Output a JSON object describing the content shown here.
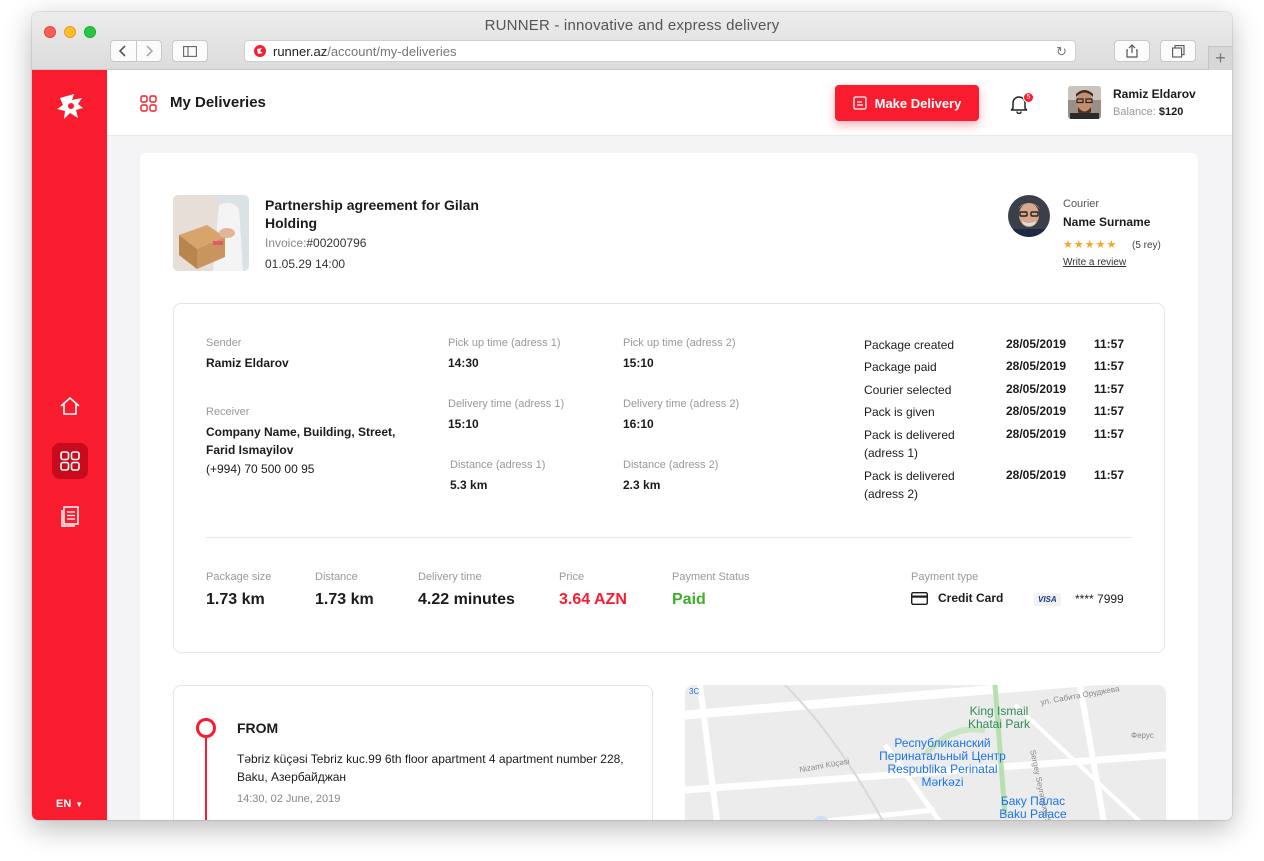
{
  "browser": {
    "title": "RUNNER - innovative and express delivery",
    "url_domain": "runner.az",
    "url_path": "/account/my-deliveries"
  },
  "sidebar": {
    "language": "EN",
    "items": [
      {
        "icon": "home-icon"
      },
      {
        "icon": "grid-icon",
        "active": true
      },
      {
        "icon": "document-icon"
      }
    ]
  },
  "header": {
    "title": "My Deliveries",
    "make_delivery_label": "Make Delivery",
    "notification_count": "5",
    "user_name": "Ramiz Eldarov",
    "balance_label": "Balance:",
    "balance_value": "$120"
  },
  "order": {
    "title": "Partnership agreement for Gilan Holding",
    "invoice_label": "Invoice:",
    "invoice_number": "#00200796",
    "date": "01.05.29 14:00"
  },
  "courier": {
    "label": "Courier",
    "name": "Name Surname",
    "stars": "★★★★★",
    "rating_count": "(5 rey)",
    "review_link": "Write a review"
  },
  "details": {
    "sender_label": "Sender",
    "sender_name": "Ramiz Eldarov",
    "receiver_label": "Receiver",
    "receiver_name": "Company Name, Building, Street, Farid Ismayilov",
    "receiver_phone": "(+994) 70 500 00 95",
    "pickup1_label": "Pick up time (adress 1)",
    "pickup1_value": "14:30",
    "pickup2_label": "Pick up time (adress 2)",
    "pickup2_value": "15:10",
    "delivery1_label": "Delivery time (adress 1)",
    "delivery1_value": "15:10",
    "delivery2_label": "Delivery time (adress 2)",
    "delivery2_value": "16:10",
    "distance1_label": "Distance (adress 1)",
    "distance1_value": "5.3 km",
    "distance2_label": "Distance (adress 2)",
    "distance2_value": "2.3 km"
  },
  "timeline": [
    {
      "label": "Package created",
      "date": "28/05/2019",
      "time": "11:57"
    },
    {
      "label": "Package paid",
      "date": "28/05/2019",
      "time": "11:57"
    },
    {
      "label": "Courier selected",
      "date": "28/05/2019",
      "time": "11:57"
    },
    {
      "label": "Pack is given",
      "date": "28/05/2019",
      "time": "11:57"
    },
    {
      "label": "Pack is delivered (adress 1)",
      "date": "28/05/2019",
      "time": "11:57"
    },
    {
      "label": "Pack is delivered (adress 2)",
      "date": "28/05/2019",
      "time": "11:57"
    }
  ],
  "summary": {
    "package_size_label": "Package size",
    "package_size_value": "1.73 km",
    "distance_label": "Distance",
    "distance_value": "1.73 km",
    "delivery_time_label": "Delivery time",
    "delivery_time_value": "4.22 minutes",
    "price_label": "Price",
    "price_value": "3.64 AZN",
    "payment_status_label": "Payment Status",
    "payment_status_value": "Paid",
    "payment_type_label": "Payment type",
    "payment_type_value": "Credit Card",
    "card_brand": "VISA",
    "card_number": "**** 7999"
  },
  "from": {
    "title": "FROM",
    "address": "Təbriz küçəsi Tebriz kuc.99 6th floor apartment 4 apartment number 228, Baku, Азербайджан",
    "time": "14:30, 02 June, 2019"
  },
  "map": {
    "park": "King Ismail Khatai Park",
    "center": "Республиканский Перинатальный Центр Respublika Perinatal Mərkəzi",
    "palace": "Баку Палас Baku Palace",
    "street1": "ул. Сабита Оруджева",
    "street2": "Nizami Küçəsi",
    "street3": "Sergey Seyrəbaxılı Str",
    "street4": "Ферус",
    "edge_label": "3C"
  },
  "colors": {
    "brand_red": "#f81c2e",
    "paid_green": "#3fae2a"
  }
}
